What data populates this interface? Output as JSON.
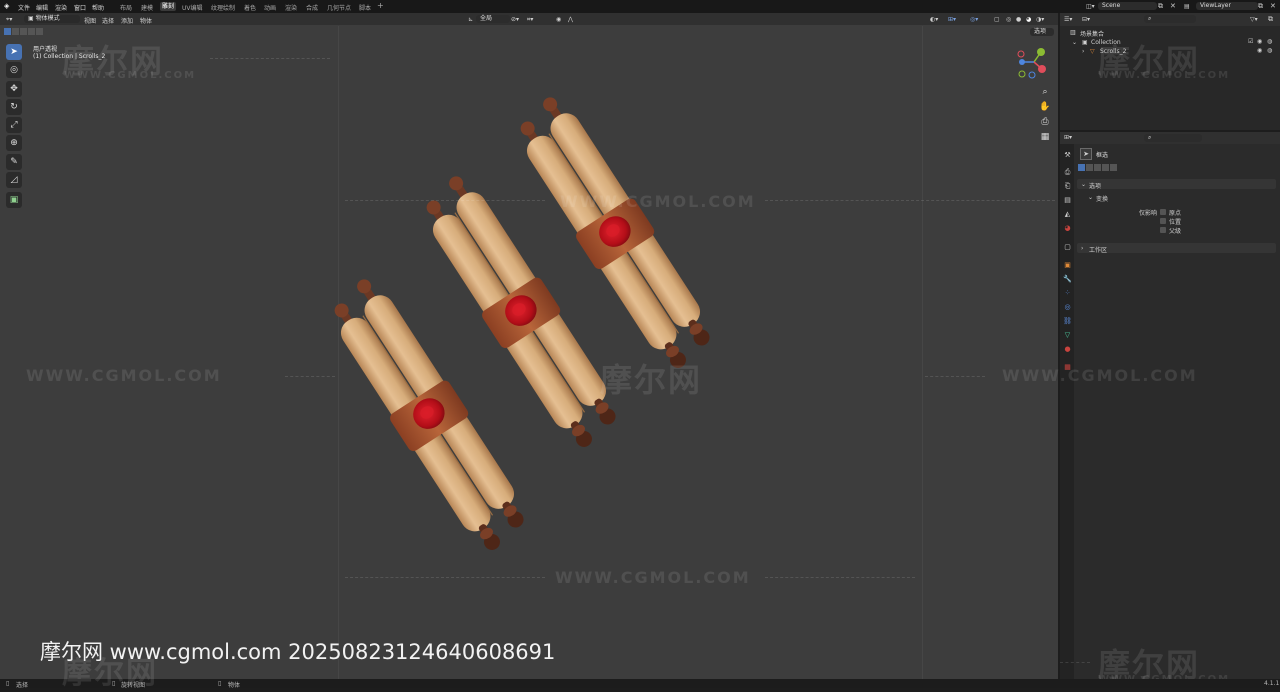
{
  "menu": [
    "文件",
    "编辑",
    "渲染",
    "窗口",
    "帮助"
  ],
  "workspaces": [
    {
      "label": "布局",
      "active": false
    },
    {
      "label": "建模",
      "active": false
    },
    {
      "label": "雕刻",
      "active": true
    },
    {
      "label": "UV编辑",
      "active": false
    },
    {
      "label": "纹理绘制",
      "active": false
    },
    {
      "label": "着色",
      "active": false
    },
    {
      "label": "动画",
      "active": false
    },
    {
      "label": "渲染",
      "active": false
    },
    {
      "label": "合成",
      "active": false
    },
    {
      "label": "几何节点",
      "active": false
    },
    {
      "label": "脚本",
      "active": false
    }
  ],
  "add_workspace": "+",
  "scene_name": "Scene",
  "view_layer": "ViewLayer",
  "viewport_header": {
    "mode": "物体模式",
    "menus": [
      "视图",
      "选择",
      "添加",
      "物体"
    ],
    "transform_orientation": "全局",
    "options": "选项"
  },
  "viewport_overlay": {
    "view_name": "用户透视",
    "collection_info": "(1) Collection | Scrolls_2"
  },
  "outliner": {
    "title": "场景集合",
    "search_placeholder": "",
    "items": [
      {
        "label": "Collection"
      },
      {
        "label": "Scrolls_2"
      }
    ]
  },
  "properties": {
    "section_title": "框选",
    "panels": [
      {
        "label": "选项"
      },
      {
        "label": "变换"
      },
      {
        "label": "工作区"
      }
    ],
    "affect_only_label": "仅影响",
    "affect_only_options": [
      "原点",
      "位置",
      "父级"
    ]
  },
  "status_bar": {
    "left": "选择",
    "middle": "旋转视图",
    "right_item": "物体",
    "version": "4.1.1"
  },
  "watermarks": {
    "logo": "摩尔网",
    "url_caps": "WWW.CGMOL.COM",
    "footer": "摩尔网 www.cgmol.com 20250823124640608691"
  },
  "colors": {
    "accent": "#4772b3",
    "viewport_bg": "#3d3d3d",
    "paper": "#d9ad7c",
    "band": "#a8542f",
    "seal": "#c5111b",
    "handle": "#5a2e1e"
  }
}
